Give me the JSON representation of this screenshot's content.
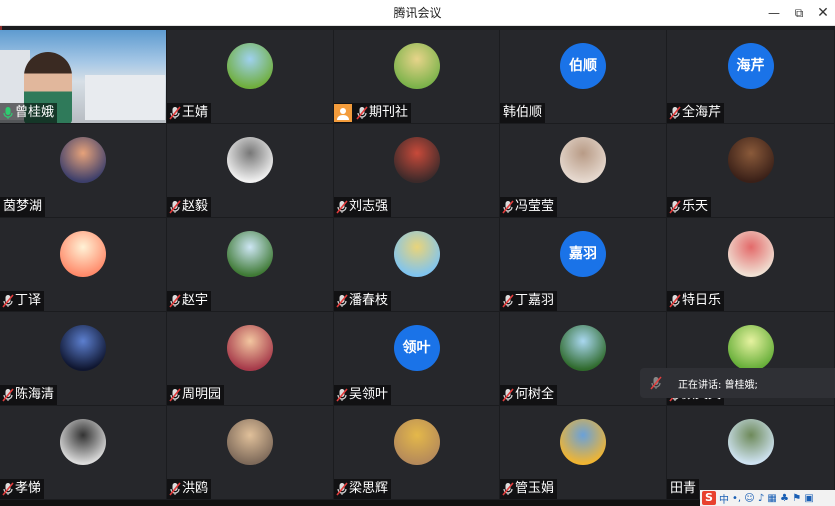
{
  "window": {
    "title": "腾讯会议",
    "min": "—",
    "max": "⧉",
    "close": "✕"
  },
  "participants": [
    {
      "name": "曾桂娥",
      "mic": "on",
      "avatar": "video",
      "active": true
    },
    {
      "name": "王婧",
      "mic": "muted",
      "avatar": "photo",
      "c1": "#6fae3c",
      "c2": "#9fd1ef"
    },
    {
      "name": "期刊社",
      "mic": "muted",
      "avatar": "photo",
      "camoff": true,
      "c1": "#7bb24a",
      "c2": "#e7d48a"
    },
    {
      "name": "韩伯顺",
      "mic": "none",
      "avatar": "text",
      "initials": "伯顺"
    },
    {
      "name": "全海芹",
      "mic": "muted",
      "avatar": "text",
      "initials": "海芹"
    },
    {
      "name": "茵梦湖",
      "mic": "none",
      "avatar": "photo",
      "c1": "#3d3f6b",
      "c2": "#e6a27a"
    },
    {
      "name": "赵毅",
      "mic": "muted",
      "avatar": "photo",
      "c1": "#f1f1f1",
      "c2": "#777"
    },
    {
      "name": "刘志强",
      "mic": "muted",
      "avatar": "photo",
      "c1": "#3d2a2a",
      "c2": "#c84a3a"
    },
    {
      "name": "冯莹莹",
      "mic": "muted",
      "avatar": "photo",
      "c1": "#e6d9cf",
      "c2": "#b89b86"
    },
    {
      "name": "乐天",
      "mic": "muted",
      "avatar": "photo",
      "c1": "#3a2018",
      "c2": "#8a5a3a"
    },
    {
      "name": "丁译",
      "mic": "muted",
      "avatar": "photo",
      "c1": "#ff8a6a",
      "c2": "#fff2d6"
    },
    {
      "name": "赵宇",
      "mic": "muted",
      "avatar": "photo",
      "c1": "#3f7a35",
      "c2": "#cde6f4"
    },
    {
      "name": "潘春枝",
      "mic": "muted",
      "avatar": "photo",
      "c1": "#7fc4f0",
      "c2": "#e9d47a"
    },
    {
      "name": "丁嘉羽",
      "mic": "muted",
      "avatar": "text",
      "initials": "嘉羽"
    },
    {
      "name": "特日乐",
      "mic": "muted",
      "avatar": "photo",
      "c1": "#f0e1d4",
      "c2": "#e36a6a"
    },
    {
      "name": "陈海清",
      "mic": "muted",
      "avatar": "photo",
      "c1": "#0f1630",
      "c2": "#5c7fcf"
    },
    {
      "name": "周明园",
      "mic": "muted",
      "avatar": "photo",
      "c1": "#a63a4a",
      "c2": "#f2c6a0"
    },
    {
      "name": "吴领叶",
      "mic": "muted",
      "avatar": "text",
      "initials": "领叶"
    },
    {
      "name": "何树全",
      "mic": "muted",
      "avatar": "photo",
      "c1": "#2f6a2c",
      "c2": "#a9d7f0"
    },
    {
      "name": "颜文文",
      "mic": "muted",
      "avatar": "photo",
      "c1": "#64ad37",
      "c2": "#e6f2a0"
    },
    {
      "name": "孝悌",
      "mic": "muted",
      "avatar": "photo",
      "c1": "#dcdcdc",
      "c2": "#333"
    },
    {
      "name": "洪鸥",
      "mic": "muted",
      "avatar": "photo",
      "c1": "#7e6a5a",
      "c2": "#e0c09a"
    },
    {
      "name": "梁思辉",
      "mic": "muted",
      "avatar": "photo",
      "c1": "#b58a5a",
      "c2": "#e4b84a"
    },
    {
      "name": "管玉娟",
      "mic": "muted",
      "avatar": "photo",
      "c1": "#f1b531",
      "c2": "#6aa1d9"
    },
    {
      "name": "田青",
      "mic": "none",
      "avatar": "photo",
      "c1": "#cfe3f2",
      "c2": "#6e8a5a"
    }
  ],
  "speaking": {
    "label": "正在讲话: 曾桂娥;"
  },
  "tray": {
    "logo": "S",
    "lang": "中",
    "icons": "•, ☺ ♪ ▦ ♣ ⚑ ▣"
  },
  "colors": {
    "accent": "#1a73e8",
    "muted_mic": "#e23c3c",
    "active_mic": "#2ecc71"
  }
}
